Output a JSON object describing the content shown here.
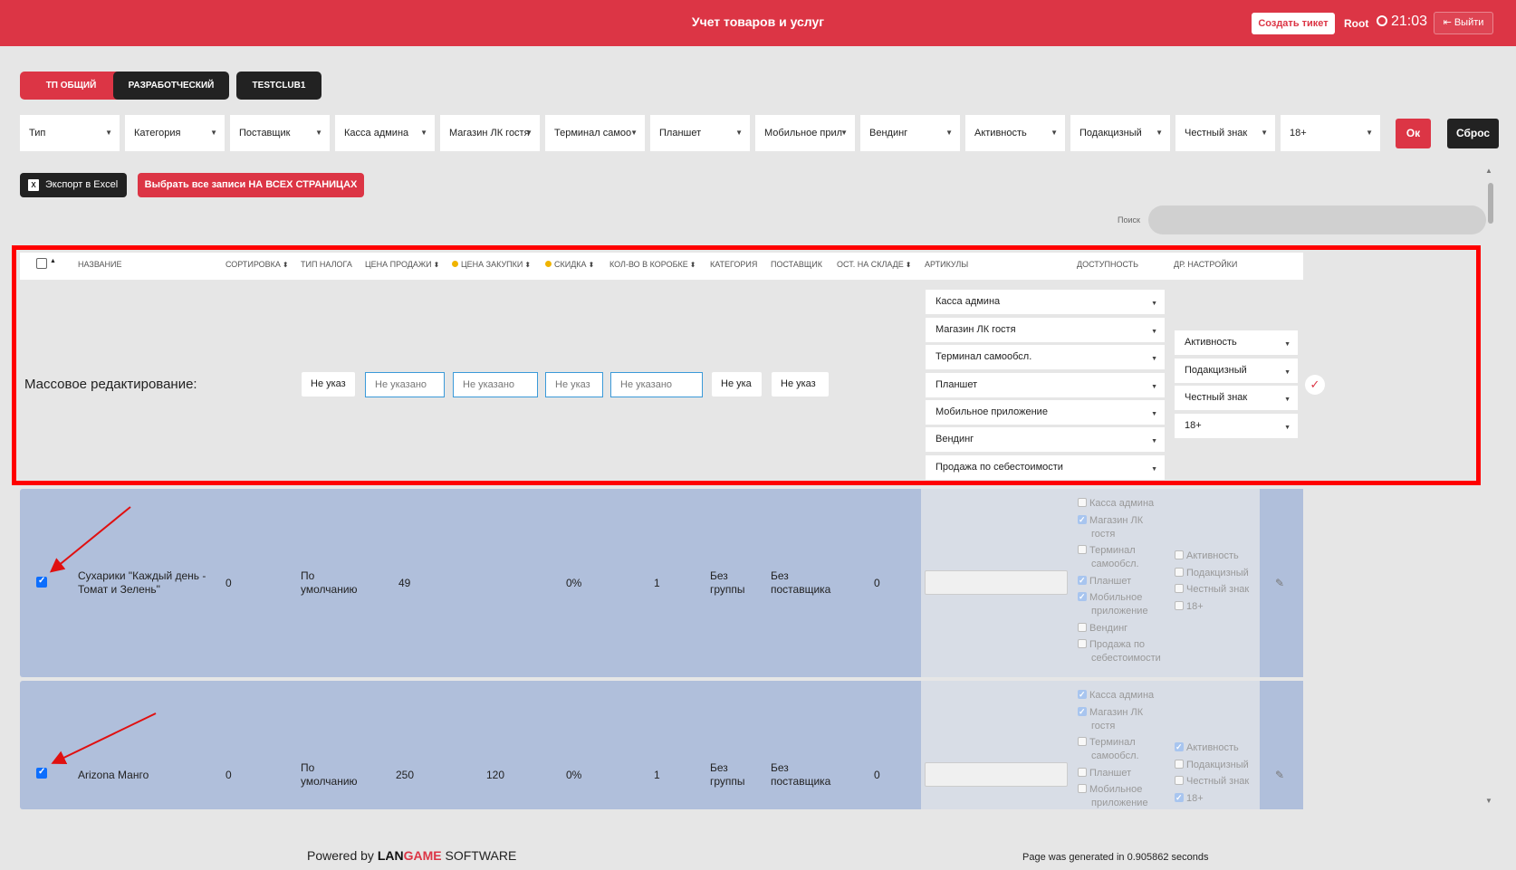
{
  "header": {
    "title": "Учет товаров и услуг",
    "ticket_button": "Создать тикет",
    "user": "Root",
    "time": "21:03",
    "logout": "Выйти"
  },
  "tabs": [
    {
      "label": "ТП ОБЩИЙ",
      "active": true
    },
    {
      "label": "РАЗРАБОТЧЕСКИЙ",
      "active": false
    },
    {
      "label": "TESTCLUB1",
      "active": false
    }
  ],
  "filters": [
    "Тип",
    "Категория",
    "Поставщик",
    "Касса админа",
    "Магазин ЛК гостя",
    "Терминал самоо",
    "Планшет",
    "Мобильное прил",
    "Вендинг",
    "Активность",
    "Подакцизный",
    "Честный знак",
    "18+"
  ],
  "filter_ok": "Ок",
  "filter_reset": "Сброс",
  "actions": {
    "excel": "Экспорт в Excel",
    "select_all": "Выбрать все записи НА ВСЕХ СТРАНИЦАХ"
  },
  "search": {
    "label": "Поиск",
    "value": ""
  },
  "columns": {
    "name": "НАЗВАНИЕ",
    "sort": "СОРТИРОВКА",
    "tax": "ТИП НАЛОГА",
    "sale_price": "ЦЕНА ПРОДАЖИ",
    "purchase_price": "ЦЕНА ЗАКУПКИ",
    "discount": "СКИДКА",
    "box_qty": "КОЛ-ВО В КОРОБКЕ",
    "category": "КАТЕГОРИЯ",
    "supplier": "ПОСТАВЩИК",
    "stock": "ОСТ. НА СКЛАДЕ",
    "articles": "АРТИКУЛЫ",
    "availability": "ДОСТУПНОСТЬ",
    "other": "ДР. НАСТРОЙКИ"
  },
  "mass_edit": {
    "title": "Массовое редактирование:",
    "tax": "Не указ",
    "sale_price": "Не указано",
    "purchase_price": "Не указано",
    "discount": "Не указ",
    "box_qty": "Не указано",
    "category": "Не ука",
    "supplier": "Не указ",
    "availability": [
      "Касса админа",
      "Магазин ЛК гостя",
      "Терминал самообсл.",
      "Планшет",
      "Мобильное приложение",
      "Вендинг",
      "Продажа по себестоимости"
    ],
    "other": [
      "Активность",
      "Подакцизный",
      "Честный знак",
      "18+"
    ]
  },
  "rows": [
    {
      "checked": true,
      "name_line1": "Сухарики \"Каждый день -",
      "name_line2": "Томат и Зелень\"",
      "sort": "0",
      "tax_line1": "По",
      "tax_line2": "умолчанию",
      "sale_price": "49",
      "purchase_price": "",
      "discount": "0%",
      "box_qty": "1",
      "category_line1": "Без",
      "category_line2": "группы",
      "supplier_line1": "Без",
      "supplier_line2": "поставщика",
      "stock": "0",
      "availability": [
        {
          "label": "Касса админа",
          "checked": false
        },
        {
          "label": "Магазин ЛК",
          "label2": "гостя",
          "checked": true
        },
        {
          "label": "Терминал",
          "label2": "самообсл.",
          "checked": false
        },
        {
          "label": "Планшет",
          "checked": true
        },
        {
          "label": "Мобильное",
          "label2": "приложение",
          "checked": true
        },
        {
          "label": "Вендинг",
          "checked": false
        },
        {
          "label": "Продажа по",
          "label2": "себестоимости",
          "checked": false
        }
      ],
      "other": [
        {
          "label": "Активность",
          "checked": false
        },
        {
          "label": "Подакцизный",
          "checked": false
        },
        {
          "label": "Честный знак",
          "checked": false
        },
        {
          "label": "18+",
          "checked": false
        }
      ]
    },
    {
      "checked": true,
      "name_line1": "Arizona Манго",
      "name_line2": "",
      "sort": "0",
      "tax_line1": "По",
      "tax_line2": "умолчанию",
      "sale_price": "250",
      "purchase_price": "120",
      "discount": "0%",
      "box_qty": "1",
      "category_line1": "Без",
      "category_line2": "группы",
      "supplier_line1": "Без",
      "supplier_line2": "поставщика",
      "stock": "0",
      "availability": [
        {
          "label": "Касса админа",
          "checked": true
        },
        {
          "label": "Магазин ЛК",
          "label2": "гостя",
          "checked": true
        },
        {
          "label": "Терминал",
          "label2": "самообсл.",
          "checked": false
        },
        {
          "label": "Планшет",
          "checked": false
        },
        {
          "label": "Мобильное",
          "label2": "приложение",
          "checked": false
        }
      ],
      "other": [
        {
          "label": "Активность",
          "checked": true
        },
        {
          "label": "Подакцизный",
          "checked": false
        },
        {
          "label": "Честный знак",
          "checked": false
        },
        {
          "label": "18+",
          "checked": true
        }
      ]
    }
  ],
  "footer": {
    "powered": "Powered by",
    "brand_lan": "LAN",
    "brand_game": "GAME",
    "brand_software": "SOFTWARE",
    "generated": "Page was generated in 0.905862 seconds"
  },
  "colors": {
    "accent": "#dc3545",
    "dark": "#222222",
    "row_selected": "#b0bfdb",
    "highlight": "#ff0000"
  }
}
